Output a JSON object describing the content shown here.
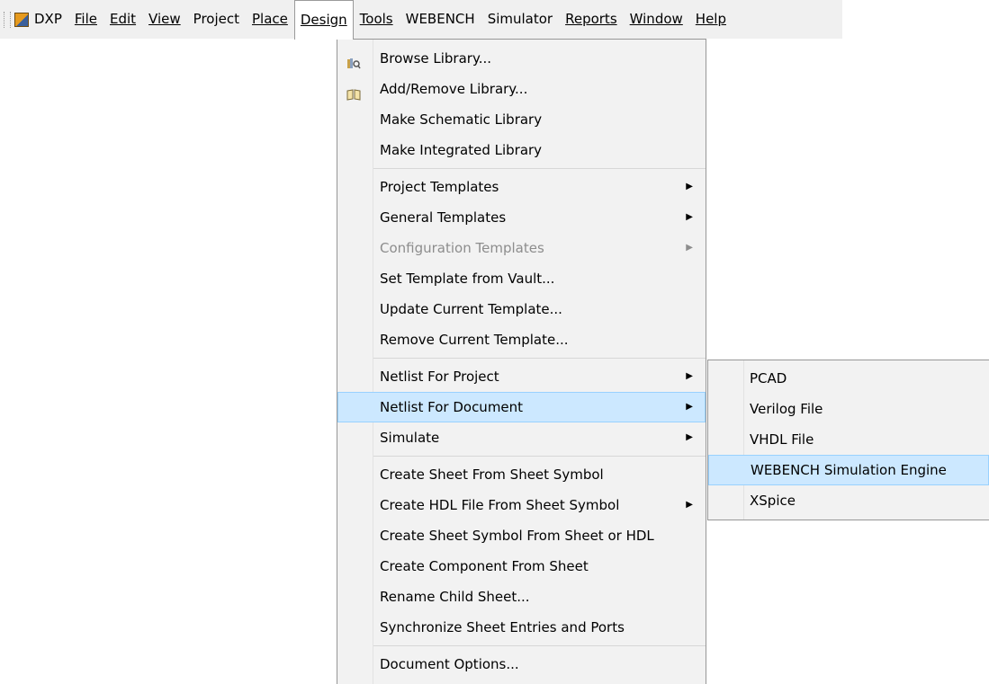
{
  "menubar": {
    "app_label": "DXP",
    "items": [
      {
        "label": "File"
      },
      {
        "label": "Edit"
      },
      {
        "label": "View"
      },
      {
        "label": "Project"
      },
      {
        "label": "Place"
      },
      {
        "label": "Design"
      },
      {
        "label": "Tools"
      },
      {
        "label": "WEBENCH"
      },
      {
        "label": "Simulator"
      },
      {
        "label": "Reports"
      },
      {
        "label": "Window"
      },
      {
        "label": "Help"
      }
    ]
  },
  "design_menu": {
    "items": [
      {
        "label": "Browse Library..."
      },
      {
        "label": "Add/Remove Library..."
      },
      {
        "label": "Make Schematic Library"
      },
      {
        "label": "Make Integrated Library"
      },
      {
        "label": "Project Templates"
      },
      {
        "label": "General Templates"
      },
      {
        "label": "Configuration Templates"
      },
      {
        "label": "Set Template from Vault..."
      },
      {
        "label": "Update Current Template..."
      },
      {
        "label": "Remove Current Template..."
      },
      {
        "label": "Netlist For Project"
      },
      {
        "label": "Netlist For Document"
      },
      {
        "label": "Simulate"
      },
      {
        "label": "Create Sheet From Sheet Symbol"
      },
      {
        "label": "Create HDL File From Sheet Symbol"
      },
      {
        "label": "Create Sheet Symbol From Sheet or HDL"
      },
      {
        "label": "Create Component From Sheet"
      },
      {
        "label": "Rename Child Sheet..."
      },
      {
        "label": "Synchronize Sheet Entries and Ports"
      },
      {
        "label": "Document Options..."
      }
    ]
  },
  "netlist_submenu": {
    "items": [
      {
        "label": "PCAD"
      },
      {
        "label": "Verilog File"
      },
      {
        "label": "VHDL File"
      },
      {
        "label": "WEBENCH Simulation Engine"
      },
      {
        "label": "XSpice"
      }
    ]
  },
  "colors": {
    "menubar_bg": "#f0f0f0",
    "menu_bg": "#f2f2f2",
    "highlight_bg": "#cce8ff",
    "highlight_border": "#99d1ff",
    "disabled_text": "#8d8d8d"
  }
}
